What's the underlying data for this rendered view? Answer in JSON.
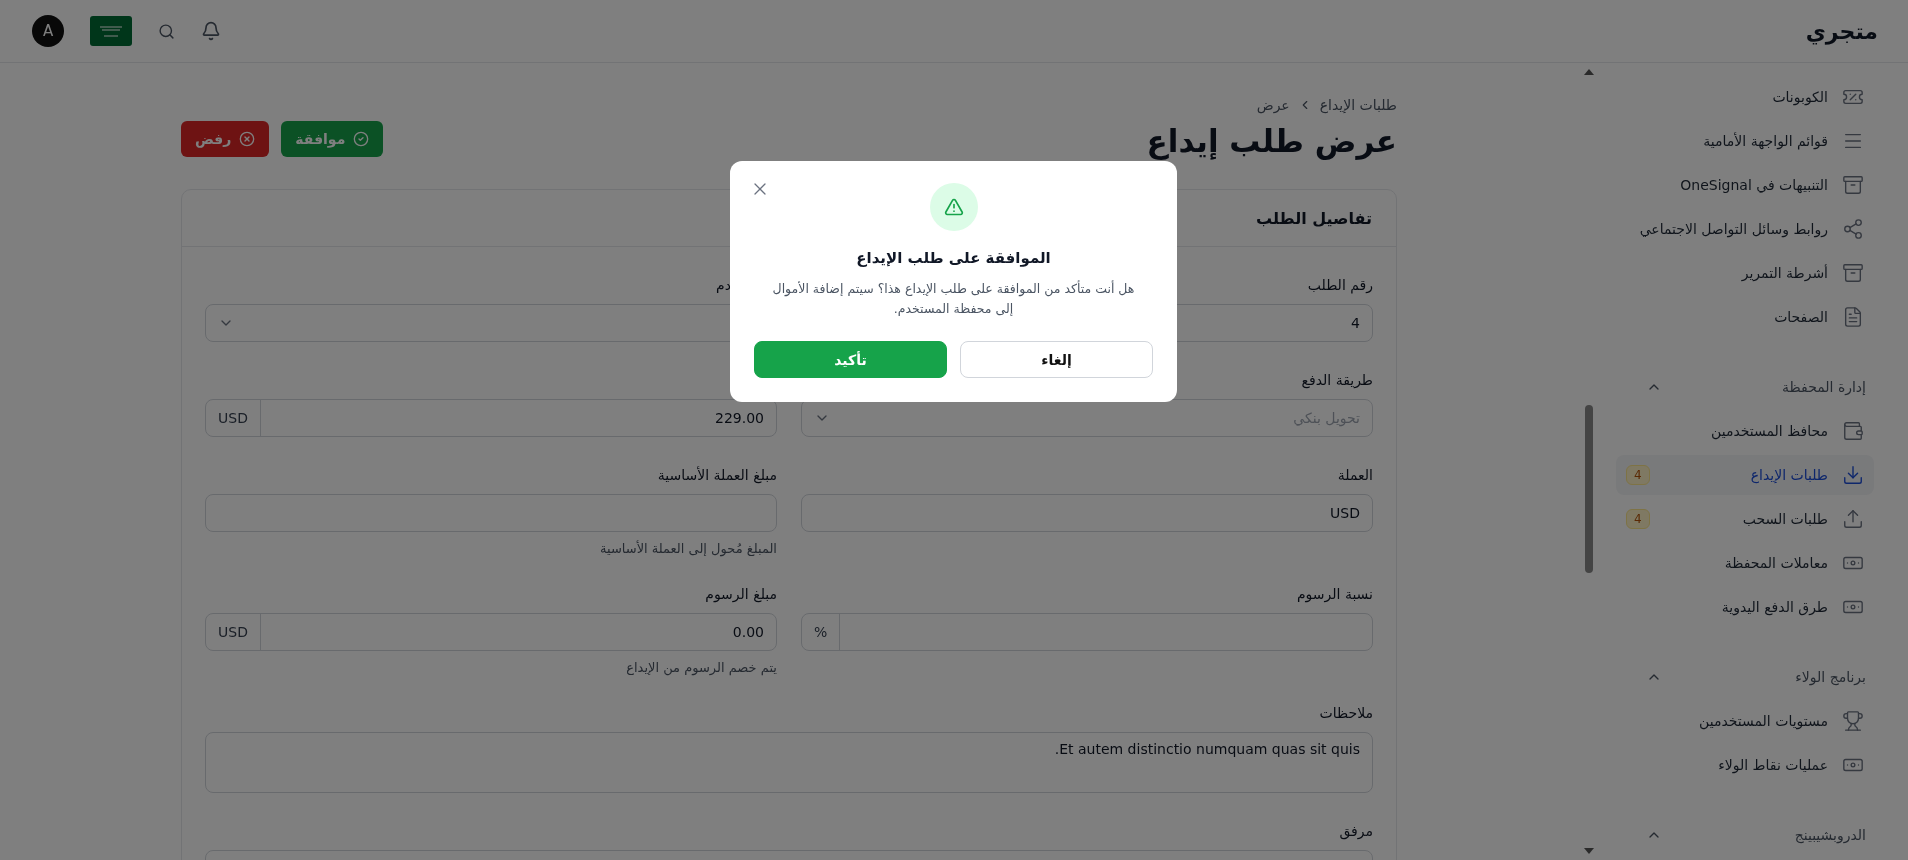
{
  "header": {
    "logo": "متجري",
    "avatar": "A"
  },
  "sidebar": {
    "sections": [
      {
        "items": [
          {
            "label": "الكوبونات",
            "selected": false
          },
          {
            "label": "قوائم الواجهة الأمامية",
            "selected": false
          },
          {
            "label": "التنبيهات في OneSignal",
            "selected": false
          },
          {
            "label": "روابط وسائل التواصل الاجتماعي",
            "selected": false
          },
          {
            "label": "أشرطة التمرير",
            "selected": false
          },
          {
            "label": "الصفحات",
            "selected": false
          }
        ]
      },
      {
        "title": "إدارة المحفظة",
        "expanded": true,
        "items": [
          {
            "label": "محافظ المستخدمين",
            "selected": false
          },
          {
            "label": "طلبات الإيداع",
            "selected": true,
            "badge": "4"
          },
          {
            "label": "طلبات السحب",
            "selected": false,
            "badge": "4"
          },
          {
            "label": "معاملات المحفظة",
            "selected": false
          },
          {
            "label": "طرق الدفع اليدوية",
            "selected": false
          }
        ]
      },
      {
        "title": "برنامج الولاء",
        "expanded": true,
        "items": [
          {
            "label": "مستويات المستخدمين",
            "selected": false
          },
          {
            "label": "عمليات نقاط الولاء",
            "selected": false
          }
        ]
      },
      {
        "title": "الدروبشيبينج",
        "expanded": true
      }
    ]
  },
  "breadcrumb": [
    "طلبات الإيداع",
    "عرض"
  ],
  "title": "عرض طلب إيداع",
  "actions": [
    {
      "kind": "approve",
      "label": "موافقة"
    },
    {
      "kind": "reject",
      "label": "رفض"
    }
  ],
  "card": {
    "title": "تفاصيل الطلب",
    "fields": [
      {
        "kind": "input",
        "label": "رقم الطلب",
        "value": "4"
      },
      {
        "kind": "select",
        "label": "دم",
        "covered": true
      },
      {
        "kind": "select",
        "label": "طريقة الدفع",
        "placeholder": "تحويل بنكي"
      },
      {
        "kind": "addon",
        "value": "229.00",
        "addon": "USD"
      },
      {
        "kind": "input",
        "label": "العملة",
        "value": "USD"
      },
      {
        "kind": "input",
        "label": "مبلغ العملة الأساسية",
        "hint": "المبلغ مُحول إلى العملة الأساسية"
      },
      {
        "kind": "addon",
        "label": "نسبة الرسوم",
        "addon": "%"
      },
      {
        "kind": "addon",
        "label": "مبلغ الرسوم",
        "value": "0.00",
        "addon": "USD",
        "hint": "يتم خصم الرسوم من الإيداع"
      },
      {
        "kind": "textarea",
        "label": "ملاحظات",
        "value": "Et autem distinctio numquam quas sit quis."
      },
      {
        "kind": "wide",
        "label": "مرفق"
      }
    ]
  },
  "dialog": {
    "title": "الموافقة على طلب الإيداع",
    "message": "هل أنت متأكد من الموافقة على طلب الإيداع هذا؟ سيتم إضافة الأموال إلى محفظة المستخدم.",
    "confirm": "تأكيد",
    "cancel": "إلغاء"
  }
}
